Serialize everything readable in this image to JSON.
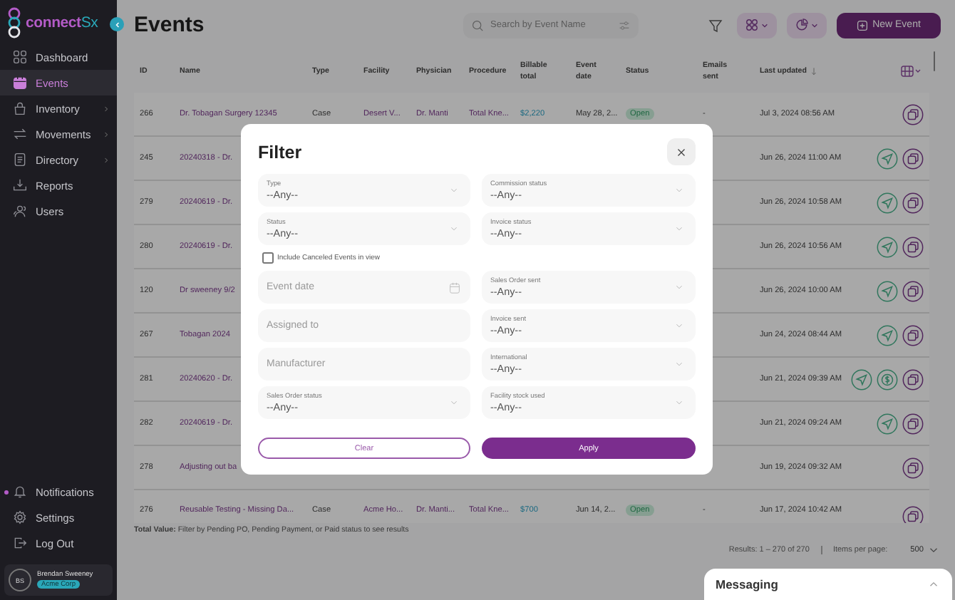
{
  "sidebar": {
    "logo": {
      "text": "connect",
      "accent": "Sx"
    },
    "nav": [
      {
        "label": "Dashboard",
        "selected": false,
        "submenu": false
      },
      {
        "label": "Events",
        "selected": true,
        "submenu": false
      },
      {
        "label": "Inventory",
        "selected": false,
        "submenu": true
      },
      {
        "label": "Movements",
        "selected": false,
        "submenu": true
      },
      {
        "label": "Directory",
        "selected": false,
        "submenu": true
      },
      {
        "label": "Reports",
        "selected": false,
        "submenu": false
      },
      {
        "label": "Users",
        "selected": false,
        "submenu": false
      }
    ],
    "bottom_nav": [
      {
        "label": "Notifications",
        "unread": true
      },
      {
        "label": "Settings",
        "unread": false
      },
      {
        "label": "Log Out",
        "unread": false
      }
    ],
    "user": {
      "initials": "BS",
      "name": "Brendan Sweeney",
      "company": "Acme Corp"
    }
  },
  "header": {
    "title": "Events",
    "search": {
      "placeholder": "Search by Event Name"
    },
    "new_button": "New Event"
  },
  "table": {
    "columns": [
      "ID",
      "Name",
      "Type",
      "Facility",
      "Physician",
      "Procedure",
      "Billable total",
      "Event date",
      "Status",
      "Emails sent",
      "Last updated"
    ],
    "rows": [
      {
        "id": "266",
        "name": "Dr. Tobagan Surgery 12345",
        "type": "Case",
        "facility": "Desert V...",
        "physician": "Dr. Manti",
        "procedure": "Total Kne...",
        "billable_total": "$2,220",
        "event_date": "May 28, 2...",
        "status": "Open",
        "emails_sent": "-",
        "last_updated": "Jul 3, 2024 08:56 AM",
        "actions": [
          {
            "kind": "copy"
          }
        ]
      },
      {
        "id": "245",
        "name": "20240318 - Dr.",
        "last_updated": "Jun 26, 2024 11:00 AM",
        "actions": [
          {
            "kind": "send"
          },
          {
            "kind": "copy"
          }
        ]
      },
      {
        "id": "279",
        "name": "20240619 - Dr.",
        "last_updated": "Jun 26, 2024 10:58 AM",
        "actions": [
          {
            "kind": "send"
          },
          {
            "kind": "copy"
          }
        ]
      },
      {
        "id": "280",
        "name": "20240619 - Dr.",
        "last_updated": "Jun 26, 2024 10:56 AM",
        "actions": [
          {
            "kind": "send"
          },
          {
            "kind": "copy"
          }
        ]
      },
      {
        "id": "120",
        "name": "Dr sweeney 9/2",
        "last_updated": "Jun 26, 2024 10:00 AM",
        "actions": [
          {
            "kind": "send"
          },
          {
            "kind": "copy"
          }
        ]
      },
      {
        "id": "267",
        "name": "Tobagan 2024",
        "last_updated": "Jun 24, 2024 08:44 AM",
        "actions": [
          {
            "kind": "send"
          },
          {
            "kind": "copy"
          }
        ]
      },
      {
        "id": "281",
        "name": "20240620 - Dr.",
        "last_updated": "Jun 21, 2024 09:39 AM",
        "actions": [
          {
            "kind": "send"
          },
          {
            "kind": "invoice"
          },
          {
            "kind": "copy"
          }
        ]
      },
      {
        "id": "282",
        "name": "20240619 - Dr.",
        "last_updated": "Jun 21, 2024 09:24 AM",
        "actions": [
          {
            "kind": "send"
          },
          {
            "kind": "copy"
          }
        ]
      },
      {
        "id": "278",
        "name": "Adjusting out ba",
        "last_updated": "Jun 19, 2024 09:32 AM",
        "actions": [
          {
            "kind": "copy"
          }
        ]
      },
      {
        "id": "276",
        "name": "Reusable Testing - Missing Da...",
        "type": "Case",
        "facility": "Acme Ho...",
        "physician": "Dr. Manti...",
        "procedure": "Total Kne...",
        "billable_total": "$700",
        "event_date": "Jun 14, 2...",
        "status": "Open",
        "emails_sent": "-",
        "last_updated": "Jun 17, 2024 10:42 AM",
        "actions": [
          {
            "kind": "copy"
          }
        ]
      }
    ]
  },
  "footer": {
    "total_value": "**Total Value:** Filter by Pending PO, Pending Payment, or Paid status to see results",
    "results": "Results: 1 – 270 of 270",
    "items_per_page": {
      "label": "Items per page:",
      "value": "500"
    }
  },
  "messaging": {
    "title": "Messaging",
    "expanded": false
  },
  "filter_dialog": {
    "title": "Filter",
    "left_fields": [
      {
        "kind": "select",
        "label": "Type",
        "value": "--Any--"
      },
      {
        "kind": "select",
        "label": "Status",
        "value": "--Any--"
      },
      {
        "kind": "checkbox",
        "label": "Include Canceled Events in view",
        "checked": false
      },
      {
        "kind": "date",
        "placeholder": "Event date"
      },
      {
        "kind": "text",
        "placeholder": "Assigned to"
      },
      {
        "kind": "text",
        "placeholder": "Manufacturer"
      },
      {
        "kind": "select",
        "label": "Sales Order status",
        "value": "--Any--"
      }
    ],
    "right_fields": [
      {
        "kind": "select",
        "label": "Commission status",
        "value": "--Any--"
      },
      {
        "kind": "select",
        "label": "Invoice status",
        "value": "--Any--"
      },
      {
        "kind": "select",
        "label": "Sales Order sent",
        "value": "--Any--"
      },
      {
        "kind": "select",
        "label": "Invoice sent",
        "value": "--Any--"
      },
      {
        "kind": "select",
        "label": "International",
        "value": "--Any--"
      },
      {
        "kind": "select",
        "label": "Facility stock used",
        "value": "--Any--"
      }
    ],
    "buttons": [
      {
        "label": "Clear",
        "kind": "secondary"
      },
      {
        "label": "Apply",
        "kind": "primary"
      }
    ]
  }
}
